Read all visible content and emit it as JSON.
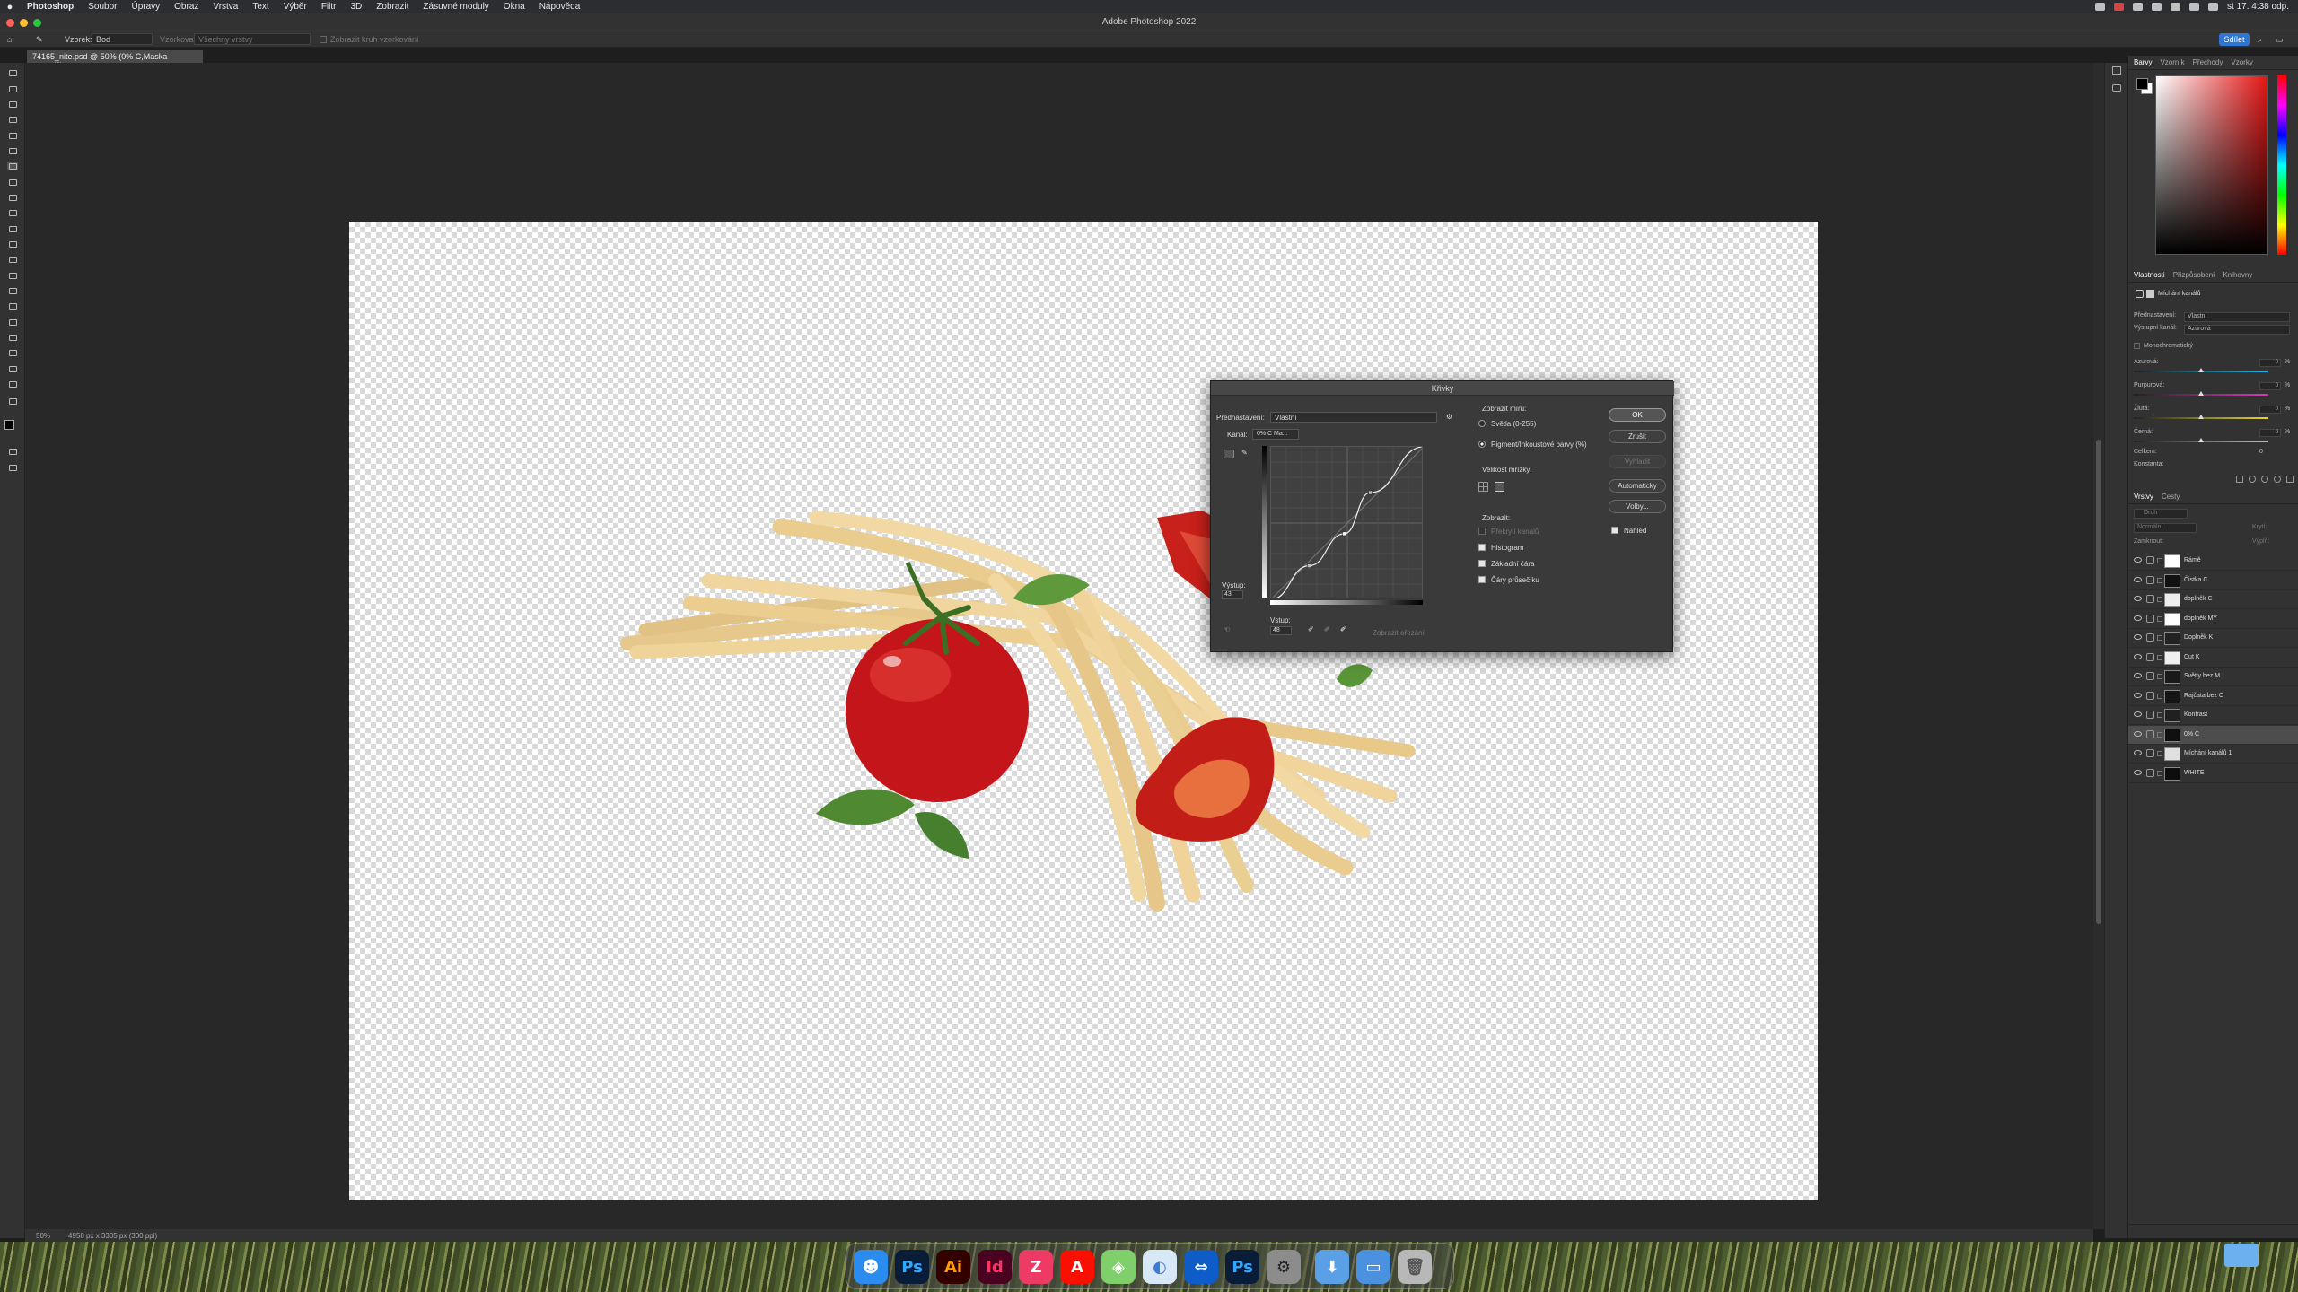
{
  "menubar": {
    "app": "Photoshop",
    "items": [
      "Soubor",
      "Úpravy",
      "Obraz",
      "Vrstva",
      "Text",
      "Výběr",
      "Filtr",
      "3D",
      "Zobrazit",
      "Zásuvné moduly",
      "Okna",
      "Nápověda"
    ],
    "clock": "st 17. 4:38 odp."
  },
  "titlebar": {
    "title": "Adobe Photoshop 2022"
  },
  "options": {
    "sample_label": "Vzorek:",
    "sample_value": "Bod",
    "field2_label": "Vzorkovat:",
    "field2_value": "Všechny vrstvy",
    "checkbox_label": "Zobrazit kruh vzorkování",
    "share": "Sdílet"
  },
  "document": {
    "tab": "74165_nite.psd @ 50% (0% C,Maska vrstvy/8)"
  },
  "status": {
    "zoom": "50%",
    "dims": "4958 px x 3305 px (300 ppi)"
  },
  "color_panel": {
    "tabs": [
      "Barvy",
      "Vzorník",
      "Přechody",
      "Vzorky"
    ],
    "foreground": "#000000",
    "background": "#ffffff"
  },
  "properties": {
    "tabs": [
      "Vlastnosti",
      "Přizpůsobení",
      "Knihovny"
    ],
    "title": "Míchání kanálů",
    "preset_label": "Přednastavení:",
    "preset_value": "Vlastní",
    "output_label": "Výstupní kanál:",
    "output_value": "Azurová",
    "mono_label": "Monochromatický",
    "sliders": [
      {
        "label": "Azurová:",
        "value": "0",
        "fill": 0.5,
        "color": "#1fb6e8"
      },
      {
        "label": "Purpurová:",
        "value": "0",
        "fill": 0.5,
        "color": "#d63bb5"
      },
      {
        "label": "Žlutá:",
        "value": "0",
        "fill": 0.5,
        "color": "#e8d72a"
      },
      {
        "label": "Černá:",
        "value": "0",
        "fill": 0.5,
        "color": "#bcbcbc"
      }
    ],
    "total_label": "Celkem:",
    "total_value": "0",
    "const_label": "Konstanta:",
    "pct": "%"
  },
  "layers": {
    "tabs": [
      "Vrstvy",
      "Cesty"
    ],
    "search_placeholder": "Druh",
    "blend": "Normální",
    "opacity_label": "Krytí:",
    "lock_label": "Zamknout:",
    "fill_label": "Výplň:",
    "items": [
      {
        "name": "Rámě",
        "sel": false,
        "thumb": "#ffffff"
      },
      {
        "name": "Čistka C",
        "sel": false,
        "thumb": "#111111"
      },
      {
        "name": "doplněk C",
        "sel": false,
        "thumb": "#eeeeee"
      },
      {
        "name": "doplněk MY",
        "sel": false,
        "thumb": "#ffffff"
      },
      {
        "name": "Doplněk K",
        "sel": false,
        "thumb": "#222222"
      },
      {
        "name": "Cut K",
        "sel": false,
        "thumb": "#f0f0f0"
      },
      {
        "name": "Světly bez M",
        "sel": false,
        "thumb": "#1a1a1a"
      },
      {
        "name": "Rajčata bez C",
        "sel": false,
        "thumb": "#151515"
      },
      {
        "name": "Kontrast",
        "sel": false,
        "thumb": "#202020"
      },
      {
        "name": "0% C",
        "sel": true,
        "thumb": "#101010"
      },
      {
        "name": "Míchání kanálů 1",
        "sel": false,
        "thumb": "#e0e0e0"
      },
      {
        "name": "WHITE",
        "sel": false,
        "thumb": "#0d0d0d"
      }
    ]
  },
  "curves": {
    "title": "Křivky",
    "preset_label": "Přednastavení:",
    "preset_value": "Vlastní",
    "channel_label": "Kanál:",
    "channel_value": "0% C Ma...",
    "show_amount_label": "Zobrazit míru:",
    "light_label": "Světla (0-255)",
    "pigment_label": "Pigment/Inkoustové barvy (%)",
    "grid_size_label": "Velikost mřížky:",
    "show_label": "Zobrazit:",
    "overlay_label": "Překrytí kanálů",
    "histogram_label": "Histogram",
    "baseline_label": "Základní čára",
    "intersection_label": "Čáry průsečíku",
    "output_label": "Výstup:",
    "output_value": "43",
    "input_label": "Vstup:",
    "input_value": "48",
    "clipping_label": "Zobrazit ořezání",
    "ok": "OK",
    "cancel": "Zrušit",
    "smooth": "Vyhladit",
    "auto": "Automaticky",
    "options": "Volby...",
    "preview": "Náhled",
    "points": [
      [
        0,
        0
      ],
      [
        25,
        22
      ],
      [
        48,
        43
      ],
      [
        65,
        70
      ],
      [
        100,
        100
      ]
    ]
  },
  "dock": {
    "apps": [
      {
        "name": "finder",
        "label": "☻",
        "color": "#2b8cf0"
      },
      {
        "name": "photoshop",
        "label": "Ps",
        "color": "#0a1d38",
        "fg": "#31a8ff"
      },
      {
        "name": "illustrator",
        "label": "Ai",
        "color": "#330000",
        "fg": "#ff9a00"
      },
      {
        "name": "indesign",
        "label": "Id",
        "color": "#49021f",
        "fg": "#ff3366"
      },
      {
        "name": "zeplin",
        "label": "Z",
        "color": "#ee3b66",
        "fg": "#ffffff"
      },
      {
        "name": "acrobat",
        "label": "A",
        "color": "#fa0f00",
        "fg": "#ffffff"
      },
      {
        "name": "maps",
        "label": "◈",
        "color": "#7fcf6a",
        "fg": "#ffffff"
      },
      {
        "name": "preview",
        "label": "◐",
        "color": "#d9e8f6",
        "fg": "#3c7bd4"
      },
      {
        "name": "teamviewer",
        "label": "⇔",
        "color": "#0e5cc7",
        "fg": "#ffffff"
      },
      {
        "name": "photoshop-2",
        "label": "Ps",
        "color": "#0a1d38",
        "fg": "#31a8ff"
      },
      {
        "name": "settings",
        "label": "⚙",
        "color": "#8c8c8c",
        "fg": "#222222"
      },
      {
        "name": "downloads",
        "label": "⬇",
        "color": "#5aa0e6",
        "fg": "#ffffff"
      },
      {
        "name": "folder",
        "label": "▭",
        "color": "#4a91df",
        "fg": "#ffffff"
      },
      {
        "name": "trash",
        "label": "🗑",
        "color": "#b8b8b8",
        "fg": "#555555"
      }
    ]
  }
}
